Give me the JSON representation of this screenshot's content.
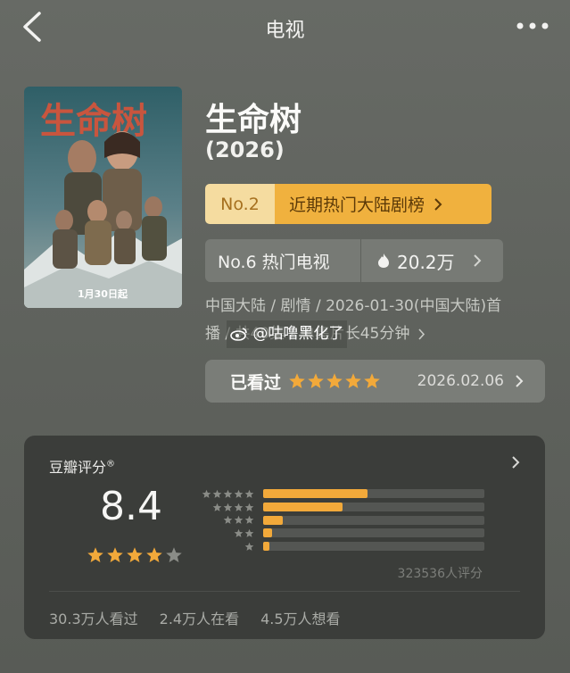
{
  "topbar": {
    "title": "电视",
    "back_icon": "chevron-left-icon",
    "more_icon": "more-dots-icon"
  },
  "show": {
    "title": "生命树",
    "year": "(2026)"
  },
  "poster": {
    "title_text": "生命树",
    "date_text": "1月30日起"
  },
  "ranking": {
    "no": "No.2",
    "board": "近期热门大陆剧榜"
  },
  "tv_rank": {
    "label": "No.6 热门电视",
    "heat": "20.2万",
    "heat_icon": "flame-icon"
  },
  "meta": {
    "line1": "中国大陆 / 剧情 / 2026-01-30(中国大陆)首",
    "line2": "播 / 共40集 / 单集片长45分钟",
    "watermark": "@咕噜黑化了"
  },
  "watched": {
    "label": "已看过",
    "stars": 5,
    "date": "2026.02.06"
  },
  "douban": {
    "title": "豆瓣评分",
    "score": "8.4",
    "stars": 4,
    "distribution_fraction": [
      0.47,
      0.36,
      0.09,
      0.04,
      0.03
    ],
    "rating_count": "323536人评分",
    "stats": [
      "30.3万人看过",
      "2.4万人在看",
      "4.5万人想看"
    ]
  },
  "colors": {
    "accent": "#f2a93a",
    "rank_badge": "#f0b13e",
    "card_bg": "#3b3d3a"
  }
}
